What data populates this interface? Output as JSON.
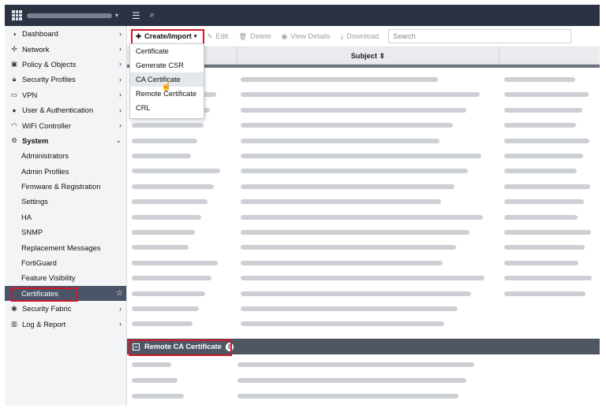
{
  "topbar": {
    "menu_icon": "hamburger-icon",
    "search_icon": "search-icon"
  },
  "sidebar": {
    "items": [
      {
        "label": "Dashboard",
        "icon": "dashboard-icon"
      },
      {
        "label": "Network",
        "icon": "network-icon"
      },
      {
        "label": "Policy & Objects",
        "icon": "policy-icon"
      },
      {
        "label": "Security Profiles",
        "icon": "lock-icon"
      },
      {
        "label": "VPN",
        "icon": "monitor-icon"
      },
      {
        "label": "User & Authentication",
        "icon": "user-icon"
      },
      {
        "label": "WiFi Controller",
        "icon": "wifi-icon"
      },
      {
        "label": "System",
        "icon": "gear-icon"
      }
    ],
    "system_children": [
      "Administrators",
      "Admin Profiles",
      "Firmware & Registration",
      "Settings",
      "HA",
      "SNMP",
      "Replacement Messages",
      "FortiGuard",
      "Feature Visibility",
      "Certificates"
    ],
    "bottom_items": [
      {
        "label": "Security Fabric",
        "icon": "fabric-icon"
      },
      {
        "label": "Log & Report",
        "icon": "chart-icon"
      }
    ]
  },
  "toolbar": {
    "create_import": "Create/Import",
    "edit": "Edit",
    "delete": "Delete",
    "view_details": "View Details",
    "download": "Download",
    "search_placeholder": "Search"
  },
  "table": {
    "subject_header": "Subject ⇕"
  },
  "dropdown": {
    "items": [
      "Certificate",
      "Generate CSR",
      "CA Certificate",
      "Remote Certificate",
      "CRL"
    ]
  },
  "section": {
    "label": "Remote CA Certificate",
    "count": "6"
  },
  "colors": {
    "highlight": "#d0182a",
    "topbar": "#2b3242",
    "active_nav": "#4b5568"
  }
}
